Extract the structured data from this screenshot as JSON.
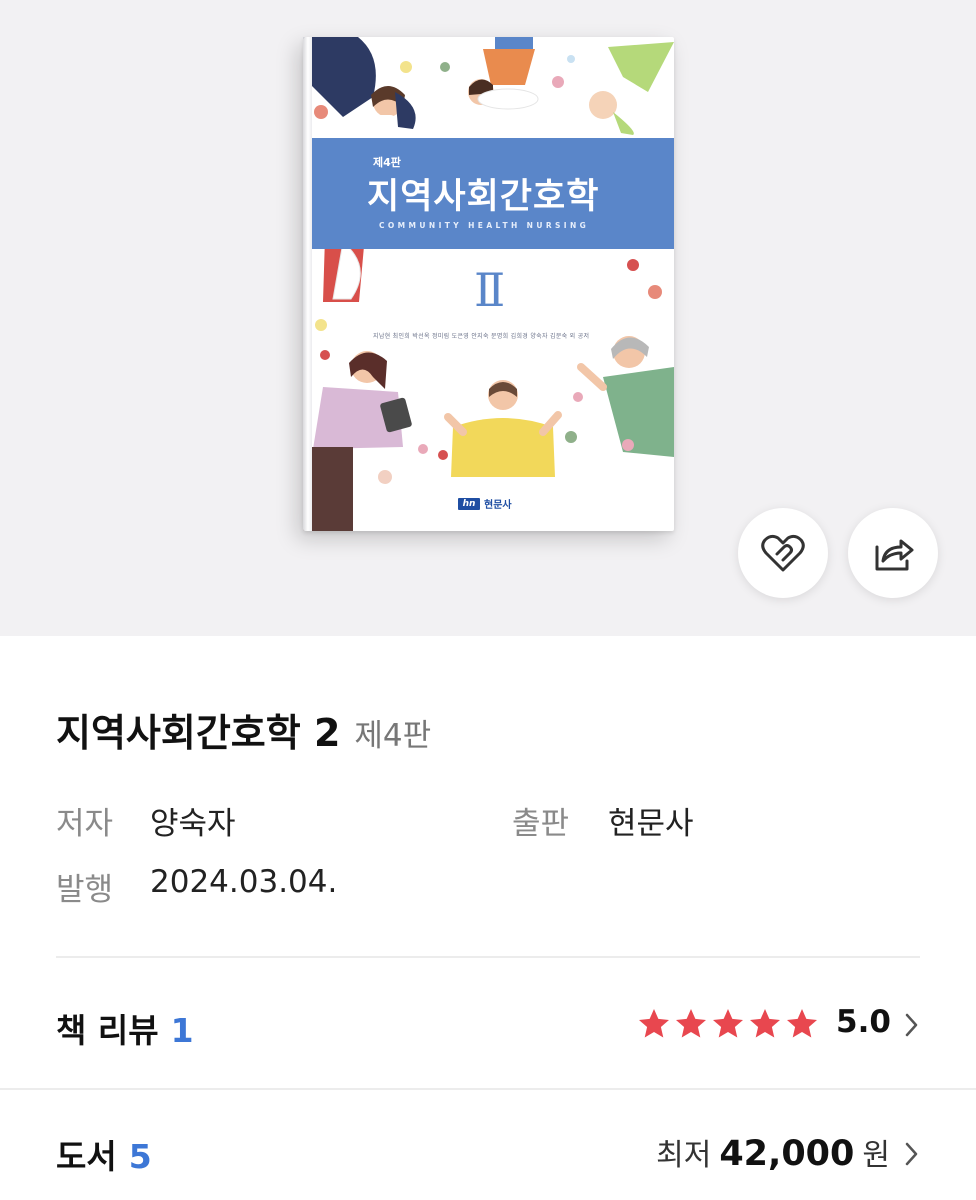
{
  "cover": {
    "edition": "제4판",
    "title": "지역사회간호학",
    "subtitle_en": "COMMUNITY HEALTH NURSING",
    "volume": "Ⅱ",
    "authors": "지남현 최인희 박선옥 정미림 도은영 안지숙 문명희 김희경 양숙자 김문숙 외 공저",
    "publisher_mark": "hn",
    "publisher": "현문사"
  },
  "actions": {
    "like_icon": "heart-outline-icon",
    "share_icon": "share-icon"
  },
  "book": {
    "title": "지역사회간호학 2",
    "edition": "제4판",
    "author_label": "저자",
    "author": "양숙자",
    "publisher_label": "출판",
    "publisher": "현문사",
    "published_label": "발행",
    "published": "2024.03.04."
  },
  "review": {
    "label": "책 리뷰",
    "count": "1",
    "stars": 5,
    "rating": "5.0",
    "star_color": "#e8474f"
  },
  "copies": {
    "label": "도서",
    "count": "5",
    "price_prefix": "최저",
    "price": "42,000",
    "price_unit": "원"
  },
  "colors": {
    "accent_blue": "#3d77d6",
    "cover_band": "#5a86c9"
  }
}
